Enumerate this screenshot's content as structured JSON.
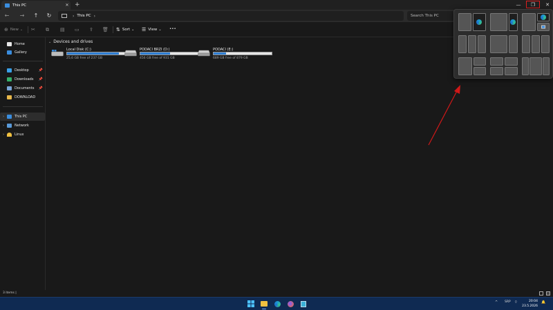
{
  "window": {
    "tab_title": "This PC",
    "tab_close": "✕",
    "new_tab": "+",
    "minimize": "—",
    "maximize": "❐",
    "close": "✕"
  },
  "nav": {
    "breadcrumb": [
      "This PC"
    ],
    "search_placeholder": "Search This PC"
  },
  "commands": {
    "new_label": "New",
    "sort_label": "Sort",
    "view_label": "View",
    "more_label": "•••"
  },
  "sidebar": {
    "items": [
      {
        "label": "Home",
        "icon": "home-icon"
      },
      {
        "label": "Gallery",
        "icon": "gallery-icon"
      },
      {
        "label": "Desktop",
        "icon": "desktop-icon",
        "pinned": true
      },
      {
        "label": "Downloads",
        "icon": "downloads-icon",
        "pinned": true
      },
      {
        "label": "Documents",
        "icon": "documents-icon",
        "pinned": true
      },
      {
        "label": "DOWNLOAD",
        "icon": "folder-icon"
      },
      {
        "label": "This PC",
        "icon": "pc-icon",
        "selected": true
      },
      {
        "label": "Network",
        "icon": "network-icon"
      },
      {
        "label": "Linux",
        "icon": "linux-icon"
      }
    ]
  },
  "main": {
    "section_title": "Devices and drives",
    "drives": [
      {
        "name": "Local Disk (C:)",
        "free": "25,6 GB free of 237 GB",
        "used_fraction": 0.89
      },
      {
        "name": "PODACI BRZI (D:)",
        "free": "456 GB free of 931 GB",
        "used_fraction": 0.51
      },
      {
        "name": "PODACI (E:)",
        "free": "689 GB free of 879 GB",
        "used_fraction": 0.22
      }
    ]
  },
  "status": {
    "items_text": "3 items",
    "separator": "|"
  },
  "taskbar": {
    "tray_chevron": "^",
    "language": "SRP",
    "time": "20:04",
    "date": "23.5.2026"
  },
  "colors": {
    "accent": "#2f7fd4",
    "taskbar": "#0f2a52",
    "highlight_border": "#e02020",
    "annotation_arrow": "#d01818"
  }
}
